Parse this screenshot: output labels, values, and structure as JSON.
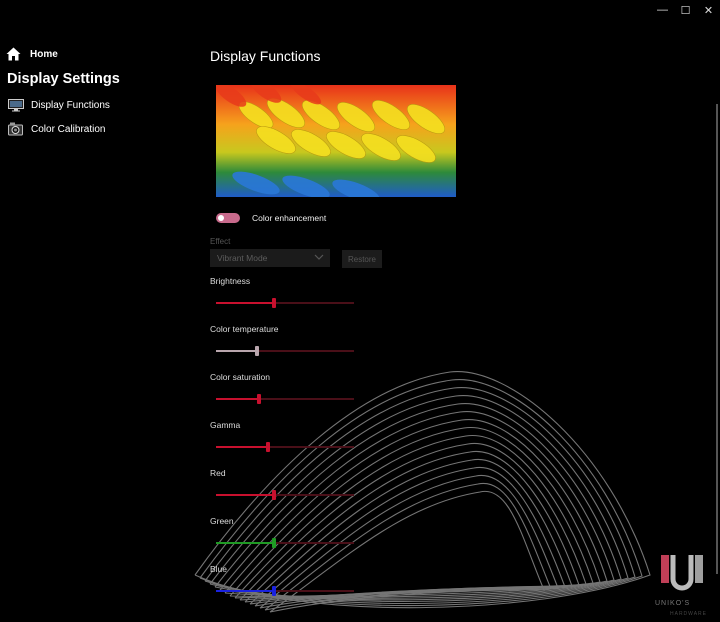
{
  "window": {
    "minimize_glyph": "—",
    "maximize_glyph": "☐",
    "close_glyph": "✕"
  },
  "sidebar": {
    "home_label": "Home",
    "section_title": "Display Settings",
    "items": [
      {
        "label": "Display Functions",
        "icon": "monitor-icon"
      },
      {
        "label": "Color Calibration",
        "icon": "calibration-icon"
      }
    ]
  },
  "main": {
    "title": "Display Functions",
    "color_enhancement": {
      "label": "Color enhancement",
      "on": true
    },
    "effect": {
      "label": "Effect",
      "selected": "Vibrant Mode",
      "restore_label": "Restore"
    },
    "sliders": [
      {
        "label": "Brightness",
        "value": 0.42,
        "color": "#c8102e"
      },
      {
        "label": "Color temperature",
        "value": 0.3,
        "color": "#b9a6ad"
      },
      {
        "label": "Color saturation",
        "value": 0.31,
        "color": "#c8102e"
      },
      {
        "label": "Gamma",
        "value": 0.38,
        "color": "#c8102e"
      },
      {
        "label": "Red",
        "value": 0.42,
        "color": "#c8102e"
      },
      {
        "label": "Green",
        "value": 0.42,
        "color": "#1f9a24"
      },
      {
        "label": "Blue",
        "value": 0.42,
        "color": "#1a22e0"
      }
    ]
  },
  "watermark": {
    "text": "UNIKO'S",
    "subtext": "HARDWARE"
  },
  "colors": {
    "accent": "#c8102e",
    "background": "#000000"
  }
}
